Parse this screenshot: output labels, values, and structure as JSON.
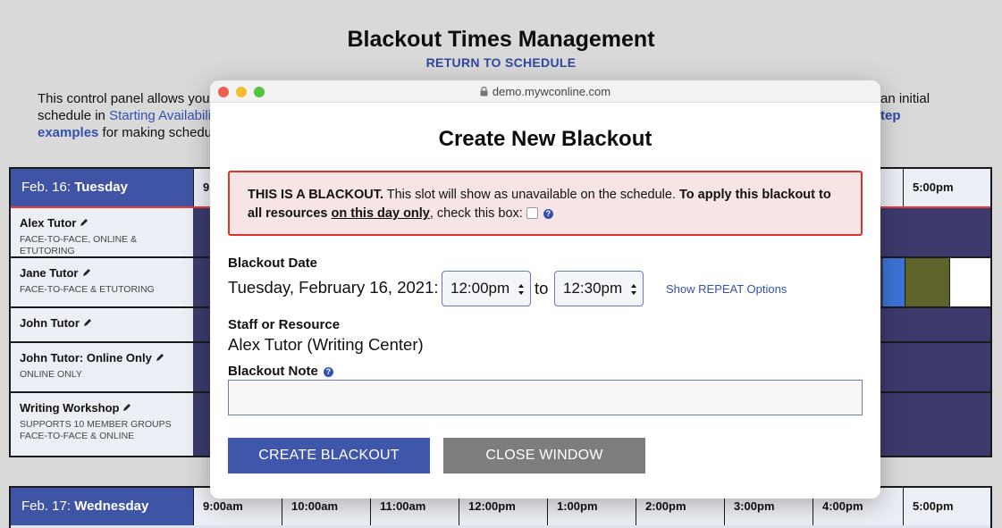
{
  "background": {
    "title": "Blackout Times Management",
    "return_link": "RETURN TO SCHEDULE",
    "intro": {
      "line1_start": "This control panel allows you t",
      "line1_end": "an initial",
      "line2_start": "schedule in ",
      "line2_link": "Starting Availabilit",
      "line2_end": "tep",
      "line3_link": "examples",
      "line3_rest": " for making schedu"
    },
    "schedule_top": {
      "date": "Feb. 16: ",
      "weekday": "Tuesday",
      "time_partial": "9:",
      "time_last": "5:00pm",
      "resources": [
        {
          "name": "Alex Tutor",
          "sub": [
            "FACE-TO-FACE, ONLINE & ETUTORING"
          ]
        },
        {
          "name": "Jane Tutor",
          "sub": [
            "FACE-TO-FACE & ETUTORING"
          ]
        },
        {
          "name": "John Tutor",
          "sub": []
        },
        {
          "name": "John Tutor: Online Only",
          "sub": [
            "ONLINE ONLY"
          ]
        },
        {
          "name": "Writing Workshop",
          "sub": [
            "SUPPORTS 10 MEMBER GROUPS",
            "FACE-TO-FACE & ONLINE"
          ]
        }
      ]
    },
    "schedule_bottom": {
      "date": "Feb. 17: ",
      "weekday": "Wednesday",
      "times": [
        "9:00am",
        "10:00am",
        "11:00am",
        "12:00pm",
        "1:00pm",
        "2:00pm",
        "3:00pm",
        "4:00pm",
        "5:00pm"
      ]
    }
  },
  "window": {
    "url": "demo.mywconline.com",
    "title": "Create New Blackout",
    "alert": {
      "strong1": "THIS IS A BLACKOUT.",
      "text1": " This slot will show as unavailable on the schedule. ",
      "strong2": "To apply this blackout to all resources ",
      "underline": "on this day only",
      "text2": ", check this box:"
    },
    "date_label": "Blackout Date",
    "date_value": "Tuesday, February 16, 2021:",
    "start_time": "12:00pm",
    "to_text": "to",
    "end_time": "12:30pm",
    "repeat_link": "Show REPEAT Options",
    "staff_label": "Staff or Resource",
    "staff_value": "Alex Tutor (Writing Center)",
    "note_label": "Blackout Note",
    "note_value": "",
    "create_button": "CREATE BLACKOUT",
    "close_button": "CLOSE WINDOW",
    "colors": {
      "accent": "#3f57aa",
      "alert_border": "#d9332b",
      "alert_bg": "#f7e5e5"
    }
  }
}
